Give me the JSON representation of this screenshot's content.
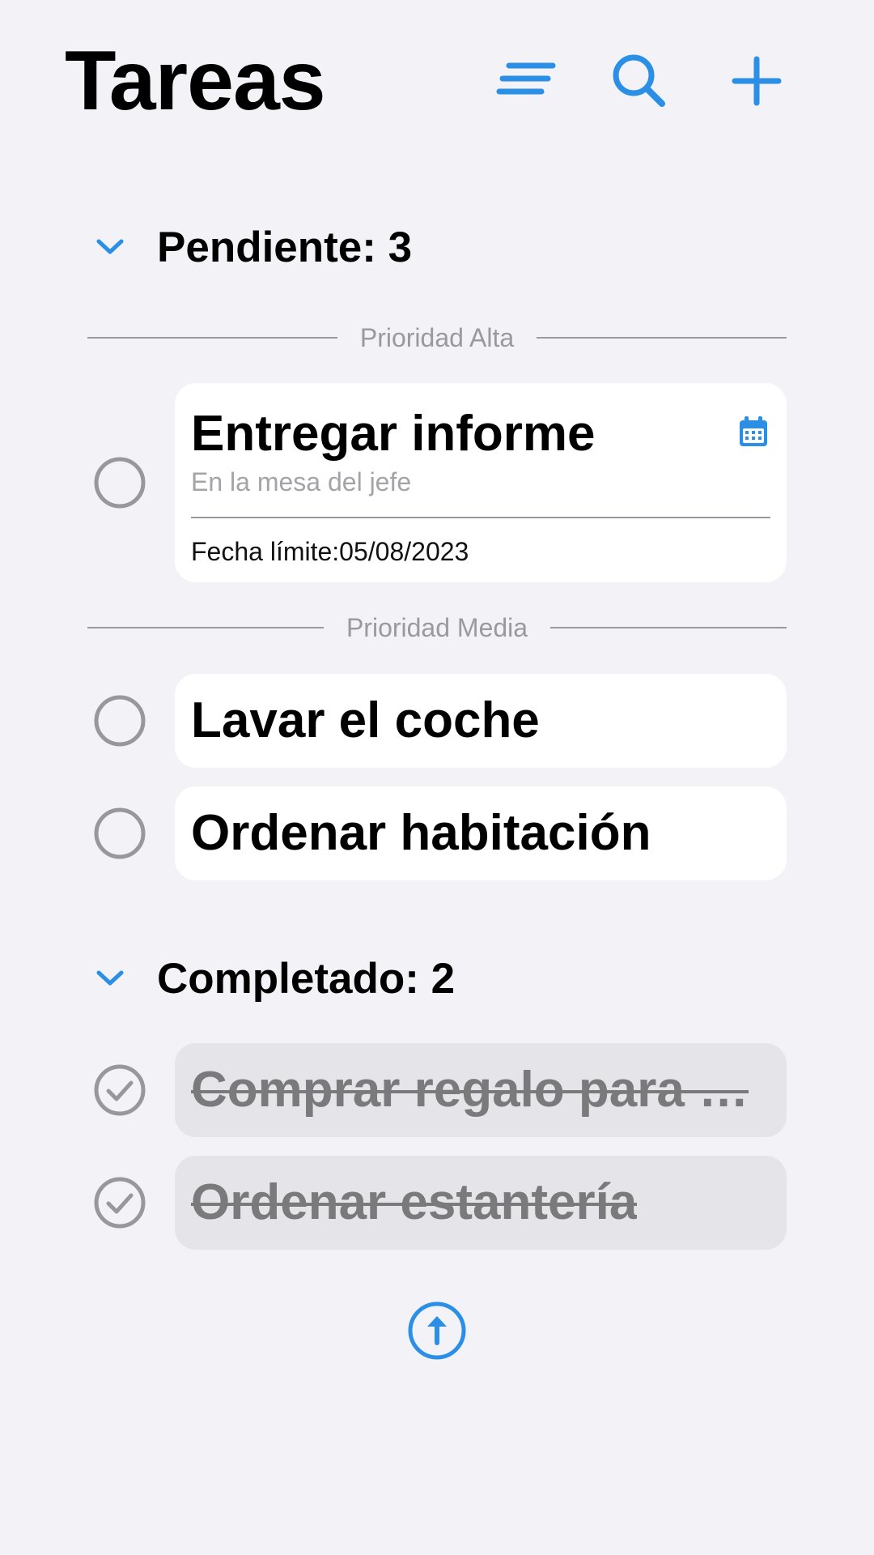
{
  "app": {
    "title": "Tareas",
    "accent_color": "#2b8fe6"
  },
  "toolbar": {
    "sort_icon": "sort-lines-icon",
    "search_icon": "search-icon",
    "add_icon": "plus-icon"
  },
  "sections": {
    "pending": {
      "title": "Pendiente: 3",
      "expanded": true,
      "groups": {
        "alta": {
          "label": "Prioridad Alta",
          "tasks": [
            {
              "title": "Entregar informe",
              "subtitle": "En la mesa del jefe",
              "due_label": "Fecha límite:",
              "due_date": "05/08/2023",
              "icon": "calendar-icon"
            }
          ]
        },
        "media": {
          "label": "Prioridad Media",
          "tasks": [
            {
              "title": "Lavar el coche"
            },
            {
              "title": "Ordenar habitación"
            }
          ]
        }
      }
    },
    "completed": {
      "title": "Completado: 2",
      "expanded": true,
      "tasks": [
        {
          "title": "Comprar regalo para …"
        },
        {
          "title": "Ordenar estantería"
        }
      ]
    }
  },
  "footer": {
    "scroll_top_icon": "arrow-up-circle-icon"
  }
}
